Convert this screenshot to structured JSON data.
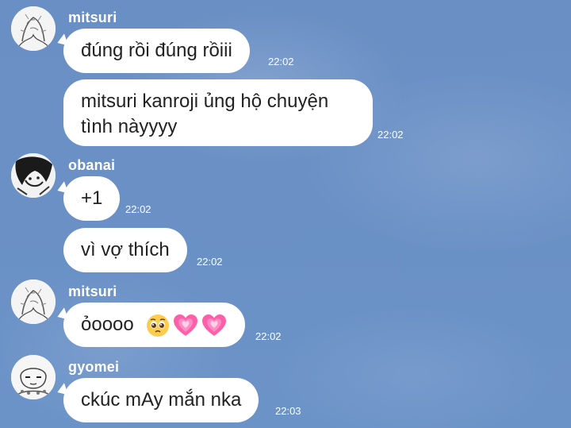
{
  "chat": {
    "messages": [
      {
        "sender": "mitsuri",
        "text": "đúng rồi đúng rồiii",
        "time": "22:02"
      },
      {
        "sender": "mitsuri",
        "text": "mitsuri kanroji ủng hộ chuyện tình nàyyyy",
        "time": "22:02"
      },
      {
        "sender": "obanai",
        "text": "+1",
        "time": "22:02"
      },
      {
        "sender": "obanai",
        "text": "vì vợ thích",
        "time": "22:02"
      },
      {
        "sender": "mitsuri",
        "text": "ỏoooo",
        "emojis": [
          "pleading-face",
          "growing-heart",
          "growing-heart"
        ],
        "time": "22:02"
      },
      {
        "sender": "gyomei",
        "text": "ckúc mAy mắn nka",
        "time": "22:03"
      }
    ]
  },
  "colors": {
    "background": "#6a8fc4",
    "bubble": "#ffffff",
    "heart": "#ff5fa8"
  }
}
